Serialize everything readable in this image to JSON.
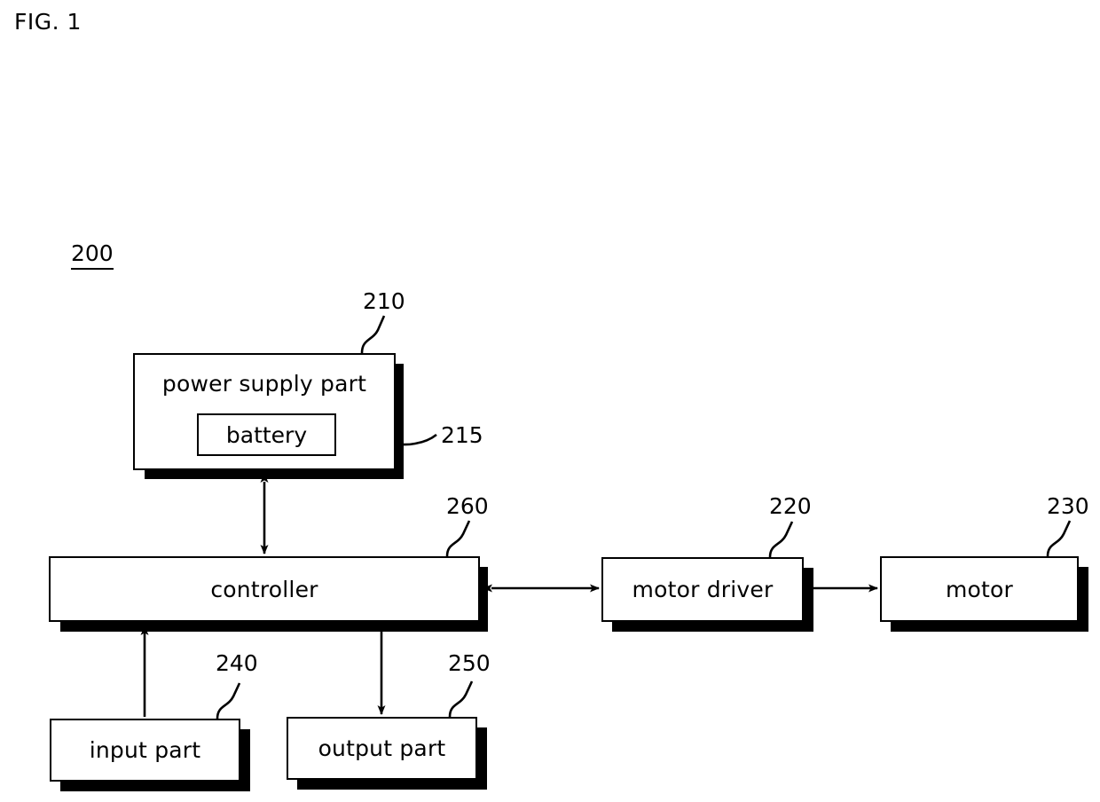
{
  "figure": {
    "label": "FIG. 1",
    "assembly_ref": "200"
  },
  "blocks": {
    "power_supply": {
      "label": "power supply part",
      "ref": "210"
    },
    "battery": {
      "label": "battery",
      "ref": "215"
    },
    "controller": {
      "label": "controller",
      "ref": "260"
    },
    "motor_driver": {
      "label": "motor driver",
      "ref": "220"
    },
    "motor": {
      "label": "motor",
      "ref": "230"
    },
    "input_part": {
      "label": "input part",
      "ref": "240"
    },
    "output_part": {
      "label": "output part",
      "ref": "250"
    }
  },
  "connections": [
    {
      "from": "controller",
      "to": "power_supply",
      "arrow": "double",
      "orientation": "vertical"
    },
    {
      "from": "controller",
      "to": "motor_driver",
      "arrow": "double",
      "orientation": "horizontal"
    },
    {
      "from": "motor_driver",
      "to": "motor",
      "arrow": "single",
      "orientation": "horizontal"
    },
    {
      "from": "input_part",
      "to": "controller",
      "arrow": "single",
      "orientation": "vertical"
    },
    {
      "from": "controller",
      "to": "output_part",
      "arrow": "single",
      "orientation": "vertical"
    }
  ],
  "colors": {
    "line": "#000000",
    "fill": "#ffffff",
    "shadow": "#000000"
  }
}
